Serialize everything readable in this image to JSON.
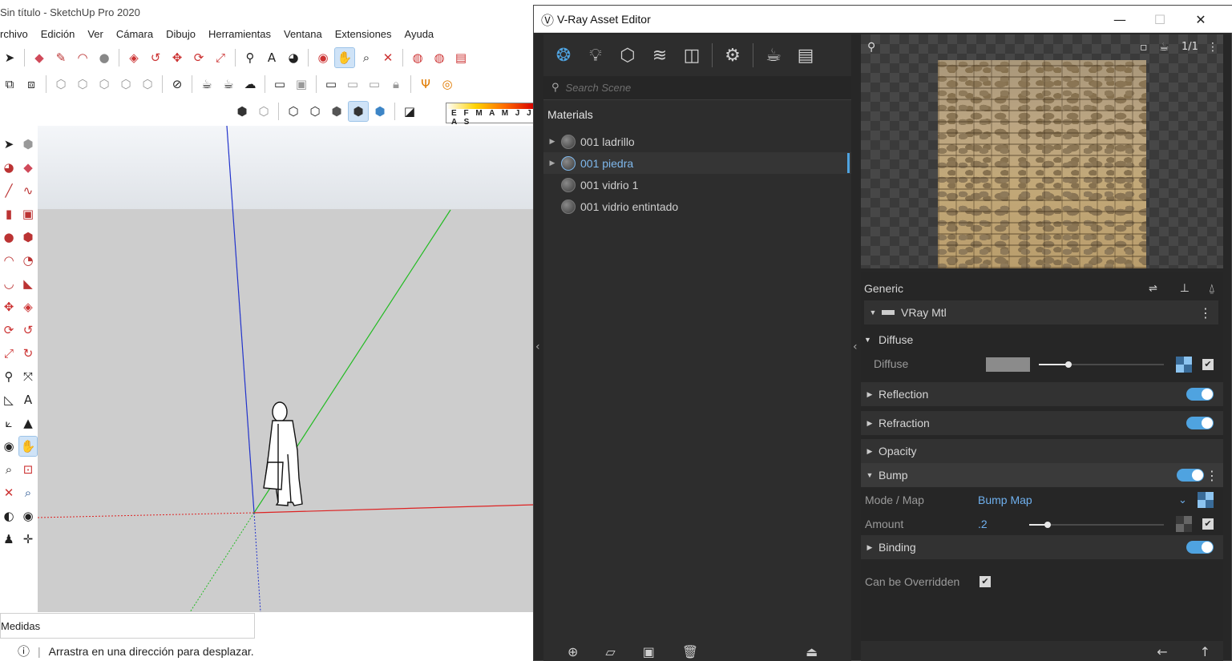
{
  "sketchup": {
    "title": "Sin título - SketchUp Pro 2020",
    "menu": [
      "rchivo",
      "Edición",
      "Ver",
      "Cámara",
      "Dibujo",
      "Herramientas",
      "Ventana",
      "Extensiones",
      "Ayuda"
    ],
    "measurements_label": "Medidas",
    "status_text": "Arrastra en una dirección para desplazar.",
    "months_label": "E F M A M J J A S"
  },
  "vray": {
    "title": "V-Ray Asset Editor",
    "search_placeholder": "Search Scene",
    "materials_header": "Materials",
    "materials": [
      {
        "name": "001 ladrillo",
        "selected": false,
        "expandable": true
      },
      {
        "name": "001 piedra",
        "selected": true,
        "expandable": true
      },
      {
        "name": "001 vidrio 1",
        "selected": false,
        "expandable": false
      },
      {
        "name": "001 vidrio entintado",
        "selected": false,
        "expandable": false
      }
    ],
    "preview_count": "1/1",
    "props": {
      "generic_label": "Generic",
      "material_type": "VRay Mtl",
      "diffuse_section": "Diffuse",
      "diffuse_label": "Diffuse",
      "diffuse_color": "#8b8b8b",
      "reflection": "Reflection",
      "refraction": "Refraction",
      "opacity": "Opacity",
      "bump": "Bump",
      "mode_map_label": "Mode / Map",
      "mode_map_value": "Bump Map",
      "amount_label": "Amount",
      "amount_value": ".2",
      "binding": "Binding",
      "can_be_overridden": "Can be Overridden"
    },
    "accent_color": "#4fa3e0"
  }
}
